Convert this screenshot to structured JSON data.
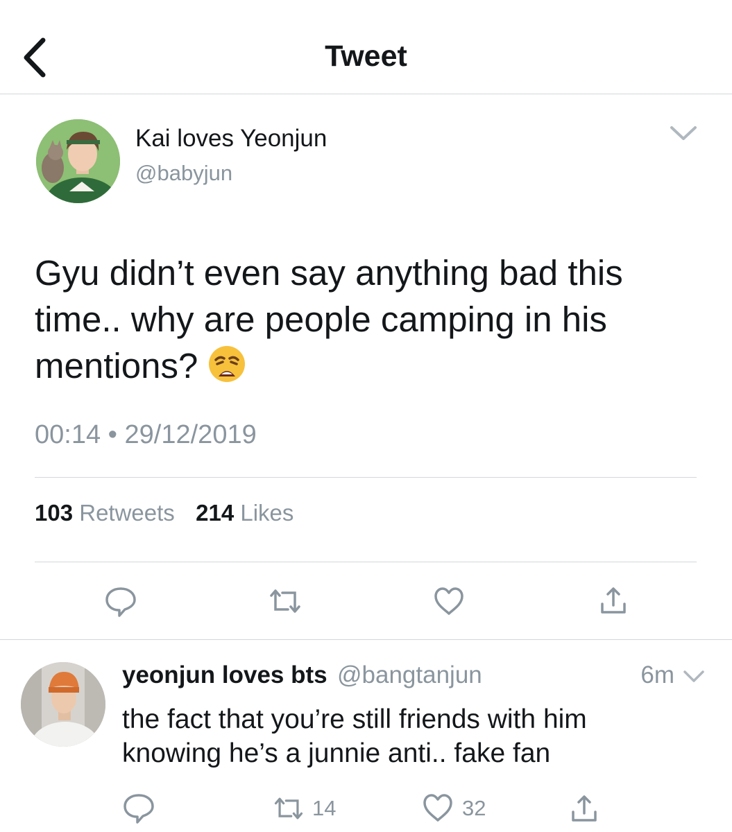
{
  "header": {
    "title": "Tweet",
    "back_icon": "chevron-left-icon"
  },
  "tweet": {
    "author": {
      "display_name": "Kai loves Yeonjun",
      "handle": "@babyjun"
    },
    "text": "Gyu didn’t even say anything bad this\ntime.. why are people camping in his\nmentions? ",
    "emoji": "😩",
    "time": "00:14",
    "separator": "•",
    "date": "29/12/2019",
    "stats": {
      "retweets_count": "103",
      "retweets_label": "Retweets",
      "likes_count": "214",
      "likes_label": "Likes"
    },
    "actions": [
      "reply-icon",
      "retweet-icon",
      "heart-icon",
      "share-icon"
    ]
  },
  "reply": {
    "display_name": "yeonjun loves bts",
    "handle": "@bangtanjun",
    "time": "6m",
    "text": "the fact that you’re still friends with him\nknowing he’s a junnie anti.. fake fan",
    "retweet_count": "14",
    "like_count": "32"
  },
  "colors": {
    "text": "#14171a",
    "secondary": "#8a959e",
    "divider": "#d3d6da",
    "emoji": "#f7c13c"
  }
}
